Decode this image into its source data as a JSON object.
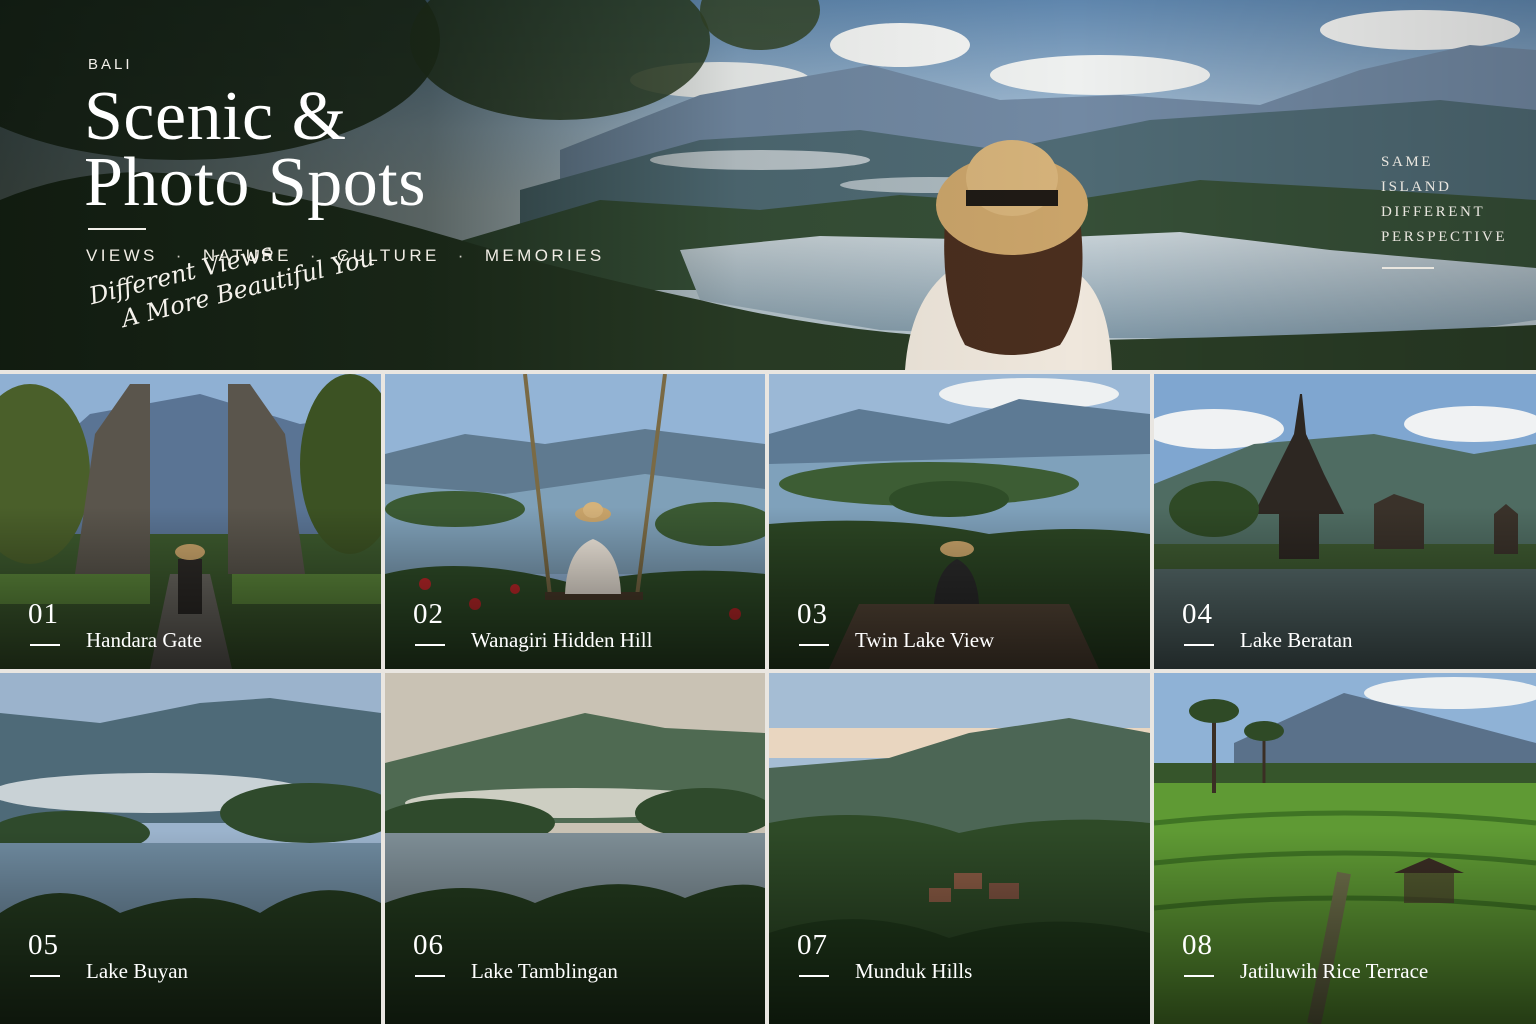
{
  "hero": {
    "kicker": "BALI",
    "title_line1": "Scenic &",
    "title_line2": "Photo Spots",
    "tags": [
      "VIEWS",
      "NATURE",
      "CULTURE",
      "MEMORIES"
    ],
    "tag_separator": "·",
    "script_line1": "Different Views",
    "script_line2": "A More Beautiful You",
    "side_lines": [
      "SAME",
      "ISLAND",
      "DIFFERENT",
      "PERSPECTIVE"
    ]
  },
  "spots": [
    {
      "number": "01",
      "name": "Handara Gate"
    },
    {
      "number": "02",
      "name": "Wanagiri Hidden Hill"
    },
    {
      "number": "03",
      "name": "Twin Lake View"
    },
    {
      "number": "04",
      "name": "Lake Beratan"
    },
    {
      "number": "05",
      "name": "Lake Buyan"
    },
    {
      "number": "06",
      "name": "Lake Tamblingan"
    },
    {
      "number": "07",
      "name": "Munduk Hills"
    },
    {
      "number": "08",
      "name": "Jatiluwih Rice Terrace"
    }
  ],
  "colors": {
    "text": "#ffffff",
    "divider": "#e9e6e1",
    "forest": "#2f4a2c",
    "lake": "#8fa9bd",
    "sky": "#a9c3dc"
  }
}
